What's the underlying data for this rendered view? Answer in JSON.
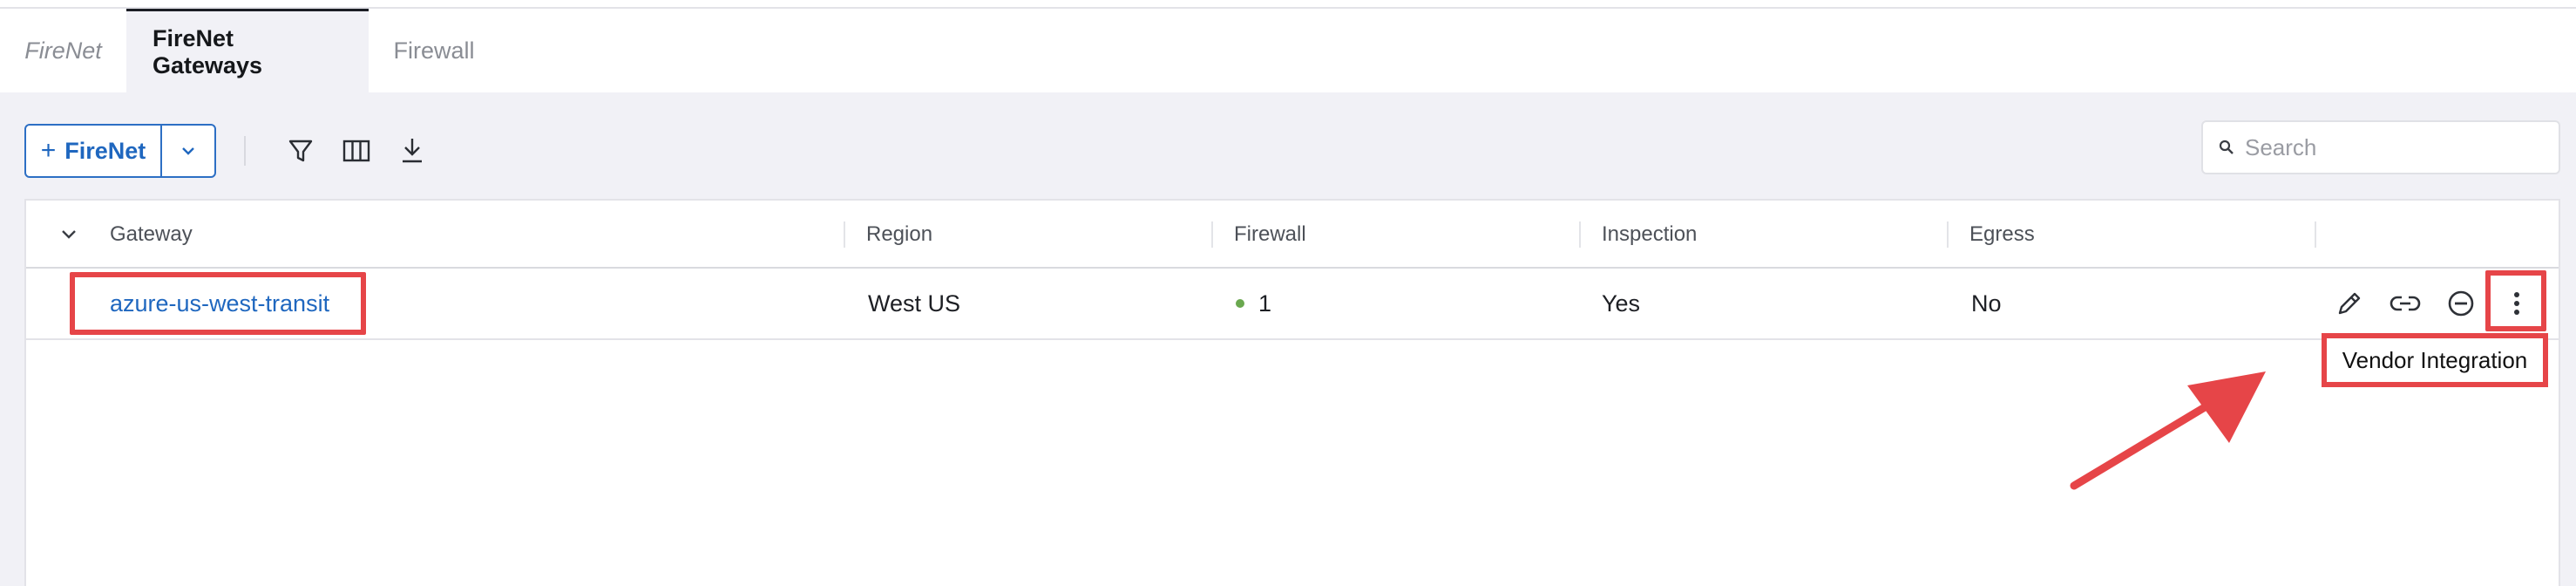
{
  "tabs": [
    {
      "label": "FireNet"
    },
    {
      "label": "FireNet Gateways"
    },
    {
      "label": "Firewall"
    }
  ],
  "toolbar": {
    "add_label": "FireNet",
    "add_plus": "+",
    "search_placeholder": "Search"
  },
  "table": {
    "columns": [
      "Gateway",
      "Region",
      "Firewall",
      "Inspection",
      "Egress"
    ],
    "rows": [
      {
        "gateway": "azure-us-west-transit",
        "region": "West US",
        "firewall": "1",
        "firewall_status_color": "#6aa84f",
        "inspection": "Yes",
        "egress": "No"
      }
    ]
  },
  "tooltip": {
    "label": "Vendor Integration"
  },
  "colors": {
    "accent": "#1f67bf",
    "annotation": "#e64548"
  },
  "icons": {
    "toolbar": [
      "filter-icon",
      "columns-icon",
      "download-icon"
    ],
    "row_actions": [
      "edit-icon",
      "link-icon",
      "remove-icon",
      "more-vertical-icon"
    ]
  }
}
